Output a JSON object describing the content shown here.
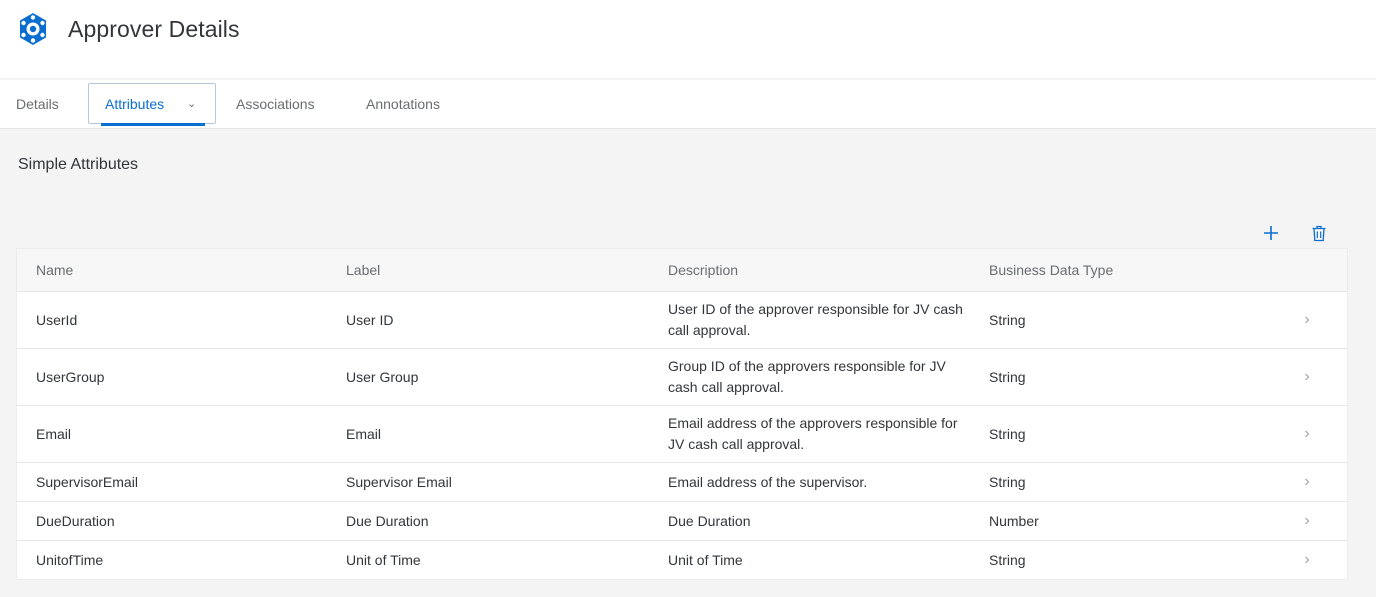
{
  "header": {
    "title": "Approver Details",
    "icon": "data-object-icon",
    "accent": "#0a6ed1"
  },
  "tabs": [
    {
      "label": "Details",
      "selected": false
    },
    {
      "label": "Attributes",
      "selected": true
    },
    {
      "label": "Associations",
      "selected": false
    },
    {
      "label": "Annotations",
      "selected": false
    }
  ],
  "section": {
    "title": "Simple Attributes"
  },
  "toolbar": {
    "add_icon": "plus-icon",
    "delete_icon": "trash-icon"
  },
  "table": {
    "columns": [
      "Name",
      "Label",
      "Description",
      "Business Data Type"
    ],
    "rows": [
      {
        "name": "UserId",
        "label": "User ID",
        "description": "User ID of the approver responsible for JV cash call approval.",
        "type": "String"
      },
      {
        "name": "UserGroup",
        "label": "User Group",
        "description": "Group ID of the approvers responsible for JV cash call approval.",
        "type": "String"
      },
      {
        "name": "Email",
        "label": "Email",
        "description": "Email address of the approvers responsible for JV cash call approval.",
        "type": "String"
      },
      {
        "name": "SupervisorEmail",
        "label": "Supervisor Email",
        "description": "Email address of the supervisor.",
        "type": "String"
      },
      {
        "name": "DueDuration",
        "label": "Due Duration",
        "description": "Due Duration",
        "type": "Number"
      },
      {
        "name": "UnitofTime",
        "label": "Unit of Time",
        "description": "Unit of Time",
        "type": "String"
      }
    ]
  }
}
